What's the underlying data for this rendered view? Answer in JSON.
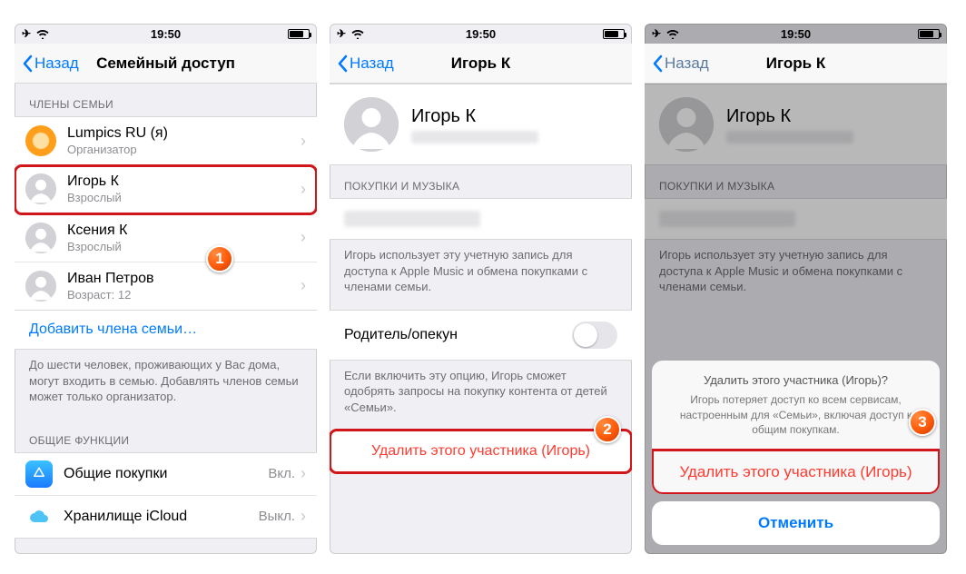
{
  "status": {
    "time": "19:50"
  },
  "nav": {
    "back": "Назад"
  },
  "screen1": {
    "title": "Семейный доступ",
    "section_members": "ЧЛЕНЫ СЕМЬИ",
    "add_member": "Добавить члена семьи…",
    "footer": "До шести человек, проживающих у Вас дома, могут входить в семью. Добавлять членов семьи может только организатор.",
    "section_shared": "ОБЩИЕ ФУНКЦИИ",
    "members": [
      {
        "name": "Lumpics RU (я)",
        "role": "Организатор"
      },
      {
        "name": "Игорь К",
        "role": "Взрослый"
      },
      {
        "name": "Ксения К",
        "role": "Взрослый"
      },
      {
        "name": "Иван Петров",
        "role": "Возраст: 12"
      }
    ],
    "shared": [
      {
        "label": "Общие покупки",
        "value": "Вкл."
      },
      {
        "label": "Хранилище iCloud",
        "value": "Выкл."
      }
    ]
  },
  "screen2": {
    "title": "Игорь К",
    "profile_name": "Игорь К",
    "section_purchases": "ПОКУПКИ И МУЗЫКА",
    "purchases_footer": "Игорь использует эту учетную запись для доступа к Apple Music и обмена покупками с членами семьи.",
    "parent_label": "Родитель/опекун",
    "parent_footer": "Если включить эту опцию, Игорь сможет одобрять запросы на покупку контента от детей «Семьи».",
    "remove": "Удалить этого участника (Игорь)"
  },
  "screen3": {
    "title": "Игорь К",
    "profile_name": "Игорь К",
    "section_purchases": "ПОКУПКИ И МУЗЫКА",
    "purchases_footer": "Игорь использует эту учетную запись для доступа к Apple Music и обмена покупками с членами семьи.",
    "sheet_title": "Удалить этого участника (Игорь)?",
    "sheet_sub": "Игорь потеряет доступ ко всем сервисам, настроенным для «Семьи», включая доступ к общим покупкам.",
    "sheet_remove": "Удалить этого участника (Игорь)",
    "sheet_cancel": "Отменить"
  }
}
